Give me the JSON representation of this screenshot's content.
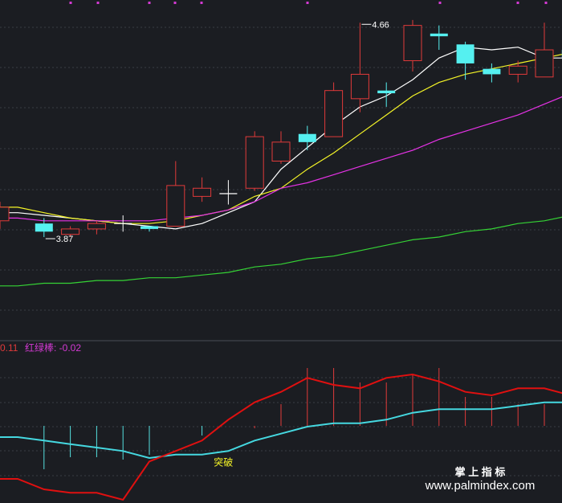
{
  "chart_data": [
    {
      "type": "candlestick",
      "panel": "price",
      "ylim": [
        3.5,
        4.72
      ],
      "x": [
        0,
        1,
        2,
        3,
        4,
        5,
        6,
        7,
        8,
        9,
        10,
        11,
        12,
        13,
        14,
        15,
        16,
        17,
        18,
        19,
        20,
        21
      ],
      "candles": [
        {
          "open": 3.93,
          "close": 3.98,
          "high": 4.0,
          "low": 3.9
        },
        {
          "open": 3.92,
          "close": 3.89,
          "high": 3.94,
          "low": 3.87
        },
        {
          "open": 3.88,
          "close": 3.9,
          "high": 3.91,
          "low": 3.87
        },
        {
          "open": 3.9,
          "close": 3.92,
          "high": 3.93,
          "low": 3.88
        },
        {
          "open": 3.92,
          "close": 3.92,
          "high": 3.95,
          "low": 3.89
        },
        {
          "open": 3.91,
          "close": 3.9,
          "high": 3.91,
          "low": 3.89
        },
        {
          "open": 3.91,
          "close": 4.06,
          "high": 4.15,
          "low": 3.91
        },
        {
          "open": 4.02,
          "close": 4.05,
          "high": 4.09,
          "low": 4.0
        },
        {
          "open": 4.03,
          "close": 4.03,
          "high": 4.08,
          "low": 3.99
        },
        {
          "open": 4.05,
          "close": 4.24,
          "high": 4.26,
          "low": 4.04
        },
        {
          "open": 4.15,
          "close": 4.22,
          "high": 4.26,
          "low": 4.14
        },
        {
          "open": 4.25,
          "close": 4.22,
          "high": 4.28,
          "low": 4.19
        },
        {
          "open": 4.24,
          "close": 4.41,
          "high": 4.44,
          "low": 4.24
        },
        {
          "open": 4.38,
          "close": 4.47,
          "high": 4.66,
          "low": 4.33
        },
        {
          "open": 4.41,
          "close": 4.4,
          "high": 4.44,
          "low": 4.35
        },
        {
          "open": 4.52,
          "close": 4.65,
          "high": 4.67,
          "low": 4.48
        },
        {
          "open": 4.62,
          "close": 4.61,
          "high": 4.65,
          "low": 4.56
        },
        {
          "open": 4.58,
          "close": 4.51,
          "high": 4.59,
          "low": 4.45
        },
        {
          "open": 4.49,
          "close": 4.47,
          "high": 4.51,
          "low": 4.44
        },
        {
          "open": 4.47,
          "close": 4.5,
          "high": 4.52,
          "low": 4.44
        },
        {
          "open": 4.46,
          "close": 4.56,
          "high": 4.66,
          "low": 4.46
        },
        {
          "open": 4.56,
          "close": 4.53,
          "high": 4.58,
          "low": 4.48
        }
      ],
      "series": [
        {
          "color": "#ffffff",
          "values": [
            3.96,
            3.95,
            3.94,
            3.93,
            3.92,
            3.91,
            3.9,
            3.92,
            3.96,
            4.0,
            4.12,
            4.2,
            4.28,
            4.35,
            4.39,
            4.45,
            4.53,
            4.57,
            4.56,
            4.57,
            4.53,
            4.53
          ]
        },
        {
          "color": "#f5f527",
          "values": [
            3.98,
            3.96,
            3.94,
            3.93,
            3.92,
            3.92,
            3.93,
            3.95,
            3.97,
            4.02,
            4.05,
            4.12,
            4.18,
            4.25,
            4.32,
            4.39,
            4.44,
            4.47,
            4.49,
            4.51,
            4.53,
            4.55
          ]
        },
        {
          "color": "#e632e6",
          "values": [
            3.94,
            3.93,
            3.93,
            3.93,
            3.93,
            3.93,
            3.94,
            3.95,
            3.97,
            4.0,
            4.05,
            4.07,
            4.1,
            4.13,
            4.16,
            4.19,
            4.23,
            4.26,
            4.29,
            4.32,
            4.36,
            4.4
          ]
        },
        {
          "color": "#35d335",
          "values": [
            3.69,
            3.7,
            3.7,
            3.71,
            3.71,
            3.72,
            3.72,
            3.73,
            3.74,
            3.76,
            3.77,
            3.79,
            3.8,
            3.82,
            3.84,
            3.86,
            3.87,
            3.89,
            3.9,
            3.92,
            3.93,
            3.95
          ]
        }
      ],
      "annotations": [
        {
          "text": "3.87",
          "x": 1,
          "y": 3.87
        },
        {
          "text": "4.66",
          "x": 13,
          "y": 4.66
        }
      ]
    },
    {
      "type": "indicator",
      "panel": "sub",
      "ylim": [
        -0.24,
        0.18
      ],
      "header": {
        "value_text": "0.11",
        "label_text": "红绿棒: -0.02"
      },
      "red_line": [
        -0.18,
        -0.21,
        -0.22,
        -0.22,
        -0.24,
        -0.13,
        -0.1,
        -0.07,
        -0.01,
        0.04,
        0.07,
        0.11,
        0.09,
        0.08,
        0.11,
        0.12,
        0.1,
        0.07,
        0.06,
        0.08,
        0.08,
        0.06
      ],
      "cyan_line": [
        -0.06,
        -0.07,
        -0.08,
        -0.09,
        -0.1,
        -0.12,
        -0.11,
        -0.11,
        -0.1,
        -0.07,
        -0.05,
        -0.03,
        -0.02,
        -0.02,
        -0.01,
        0.01,
        0.02,
        0.02,
        0.02,
        0.03,
        0.04,
        0.04
      ],
      "bars": [
        0,
        -0.18,
        -0.13,
        -0.13,
        -0.14,
        -0.12,
        0,
        -0.04,
        0,
        -0.01,
        0.03,
        0.08,
        0.08,
        0.06,
        0.06,
        0.07,
        0.08,
        0.04,
        0.04,
        0.03,
        0.03,
        0.02
      ],
      "bar_colors": [
        "#55e0e0",
        "#55e0e0",
        "#55e0e0",
        "#55e0e0",
        "#55e0e0",
        "#55e0e0",
        "#55e0e0",
        "#55e0e0",
        "#55e0e0",
        "#e03a3a",
        "#e03a3a",
        "#e03a3a",
        "#e03a3a",
        "#e03a3a",
        "#e03a3a",
        "#e03a3a",
        "#e03a3a",
        "#e03a3a",
        "#e03a3a",
        "#e03a3a",
        "#e03a3a",
        "#e03a3a"
      ],
      "signal": {
        "text": "突破",
        "x": 7.6,
        "y": -0.11
      }
    }
  ],
  "watermark": {
    "line1": "掌 上 指 标",
    "line2": "www.palmindex.com"
  },
  "colors": {
    "background": "#1b1d22",
    "grid": "#3a3d44",
    "up": "#e03a3a",
    "down": "#55f0f0",
    "accent_magenta": "#d43ad4"
  }
}
